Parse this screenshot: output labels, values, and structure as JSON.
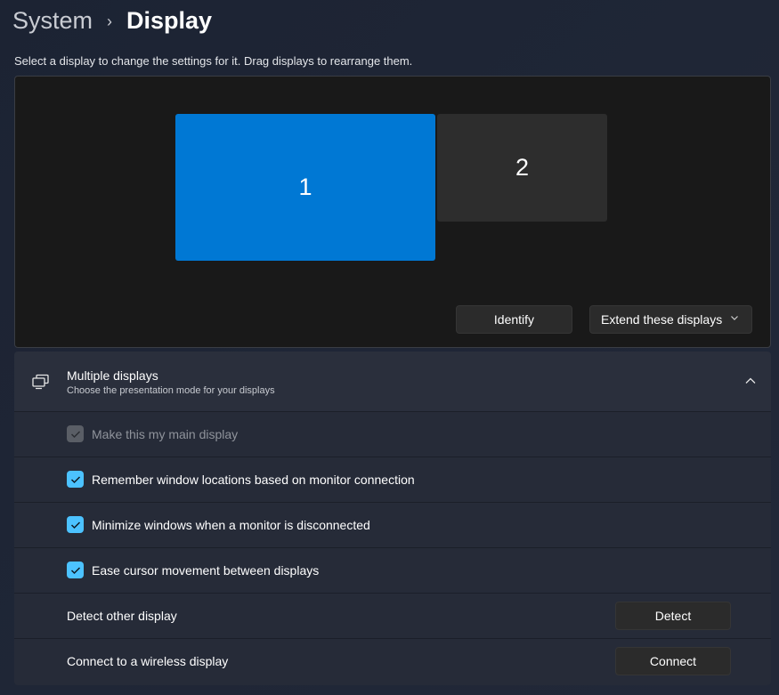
{
  "breadcrumb": {
    "parent": "System",
    "separator": "›",
    "current": "Display"
  },
  "instruction": "Select a display to change the settings for it. Drag displays to rearrange them.",
  "arrangement": {
    "monitors": [
      {
        "label": "1",
        "selected": true,
        "color": "#0078d4"
      },
      {
        "label": "2",
        "selected": false,
        "color": "#2d2d2d"
      }
    ],
    "identify_label": "Identify",
    "mode_select": {
      "value": "Extend these displays",
      "icon": "chevron-down-icon"
    }
  },
  "multiple_displays": {
    "icon": "multiple-displays-icon",
    "title": "Multiple displays",
    "subtitle": "Choose the presentation mode for your displays",
    "expanded": true,
    "options": [
      {
        "label": "Make this my main display",
        "checked": true,
        "disabled": true
      },
      {
        "label": "Remember window locations based on monitor connection",
        "checked": true,
        "disabled": false
      },
      {
        "label": "Minimize windows when a monitor is disconnected",
        "checked": true,
        "disabled": false
      },
      {
        "label": "Ease cursor movement between displays",
        "checked": true,
        "disabled": false
      }
    ],
    "detect": {
      "label": "Detect other display",
      "button": "Detect"
    },
    "connect": {
      "label": "Connect to a wireless display",
      "button": "Connect"
    }
  },
  "colors": {
    "accent": "#0078d4",
    "checkbox": "#4cc2ff"
  }
}
